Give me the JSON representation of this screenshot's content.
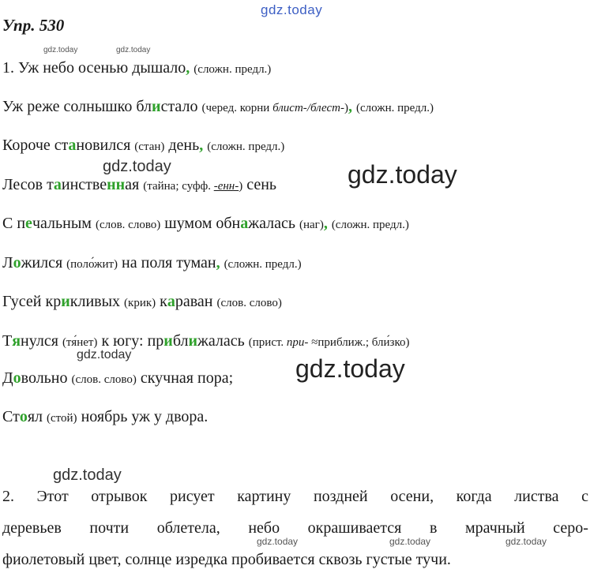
{
  "watermarks": {
    "top": "gdz.today",
    "small_1": "gdz.today",
    "small_2": "gdz.today",
    "mid_1": "gdz.today",
    "big_1": "gdz.today",
    "mid_2": "gdz.today",
    "big_2": "gdz.today",
    "mid_3": "gdz.today",
    "bottom_1": "gdz.today",
    "bottom_2": "gdz.today",
    "bottom_3": "gdz.today"
  },
  "exercise": {
    "title": "Упр. 530"
  },
  "lines": {
    "l1": {
      "main": "1. Уж небо осенью дышало",
      "comma": ",",
      "note": "(сложн. предл.)"
    },
    "l2": {
      "a": "Уж реже солнышко бл",
      "b": "и",
      "c": "стало",
      "note1": "(черед. корни ",
      "note_it": "блист-/блест-",
      "note2": ")",
      "comma": ",",
      "note3": "(сложн. предл.)"
    },
    "l3": {
      "a": "Короче ст",
      "b": "а",
      "c": "новился",
      "note": "(стан)",
      "d": "день",
      "comma": ",",
      "note2": "(сложн. предл.)"
    },
    "l4": {
      "a": "Лесов т",
      "b": "а",
      "c": "инстве",
      "d": "нн",
      "e": "ая",
      "note1": "(тайна; суфф. ",
      "note_it": "-енн-",
      "note2": ")",
      "f": "сень"
    },
    "l5": {
      "a": "С п",
      "b": "е",
      "c": "чальным",
      "note": "(слов. слово)",
      "d": "шумом обн",
      "e": "а",
      "f": "жалась",
      "note2": "(наг)",
      "comma": ",",
      "note3": "(сложн. предл.)"
    },
    "l6": {
      "a": "Л",
      "b": "о",
      "c": "жился",
      "note": "(поло́жит)",
      "d": "на поля туман",
      "comma": ",",
      "note2": "(сложн. предл.)"
    },
    "l7": {
      "a": "Гусей кр",
      "b": "и",
      "c": "кливых",
      "note": "(крик)",
      "d": "к",
      "e": "а",
      "f": "раван",
      "note2": "(слов. слово)"
    },
    "l8": {
      "a": "Т",
      "b": "я",
      "c": "нулся",
      "note": "(тя́нет)",
      "d": "к югу: пр",
      "e": "и",
      "f": "бл",
      "g": "и",
      "h": "жалась",
      "note1": "(прист. ",
      "note_it": "при-",
      "note2": " ≈приближ.; бли́зко)"
    },
    "l9": {
      "a": "Д",
      "b": "о",
      "c": "вольно",
      "note": "(слов. слово)",
      "d": "скучная пора;"
    },
    "l10": {
      "a": "Ст",
      "b": "о",
      "c": "ял",
      "note": "(стой)",
      "d": "ноябрь уж у двора."
    }
  },
  "paragraph2": {
    "row1": [
      "2.",
      "Этот",
      "отрывок",
      "рисует",
      "картину",
      "поздней",
      "осени,",
      "когда",
      "листва",
      "с"
    ],
    "row2": [
      "деревьев",
      "почти",
      "облетела,",
      "небо",
      "окрашивается",
      "в",
      "мрачный",
      "серо-"
    ],
    "row3": "фиолетовый цвет, солнце изредка пробивается сквозь густые тучи."
  }
}
